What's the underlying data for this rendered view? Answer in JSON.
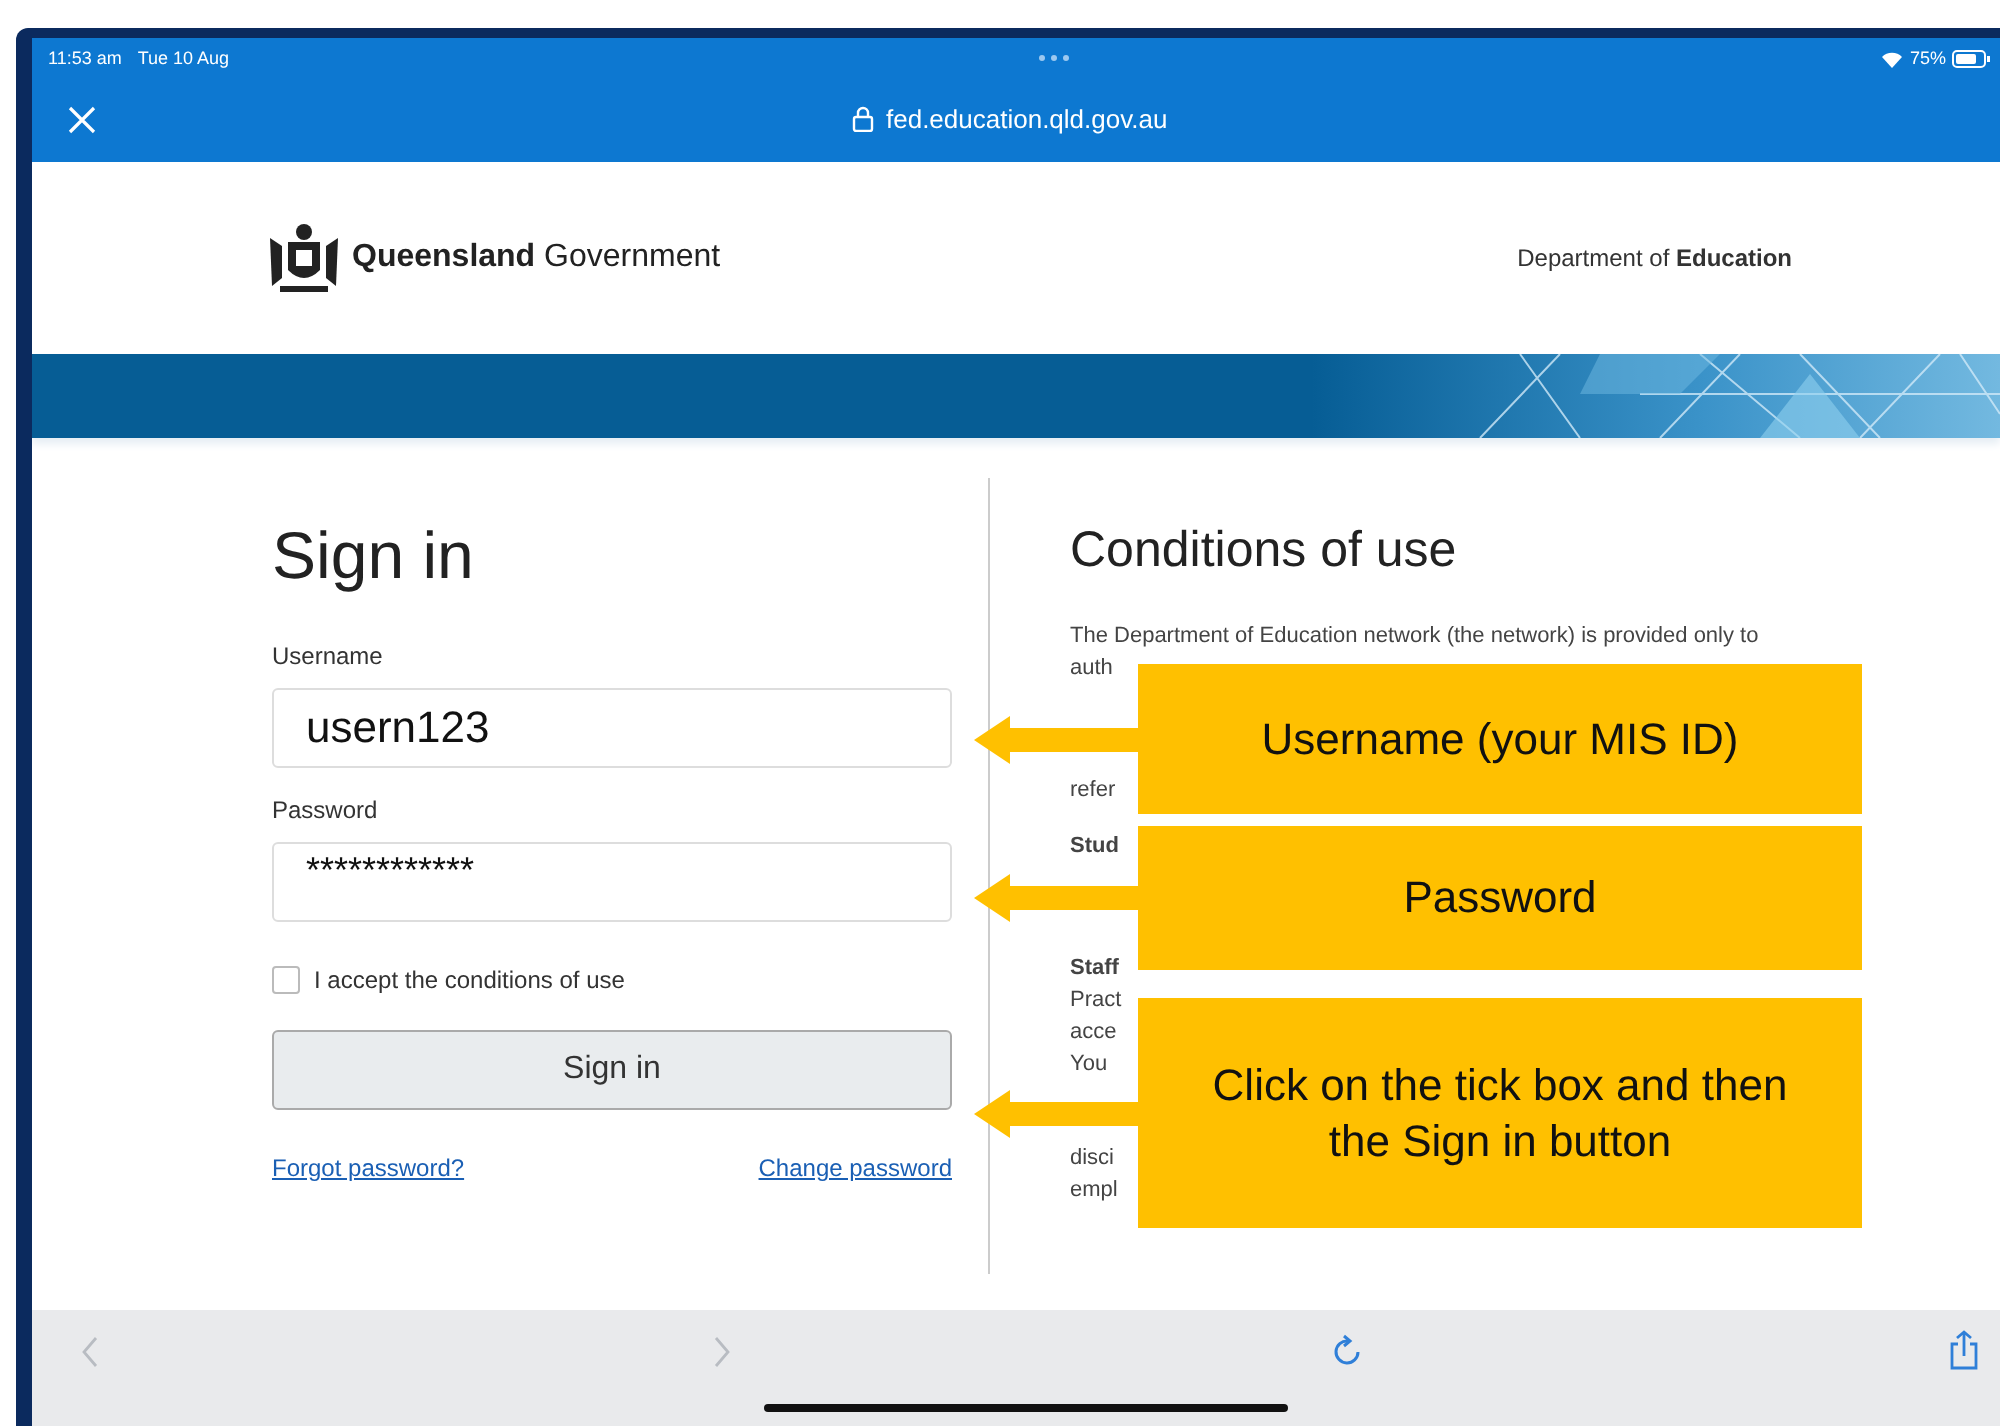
{
  "status_bar": {
    "time": "11:53 am",
    "date": "Tue 10 Aug",
    "battery": "75%"
  },
  "address_bar": {
    "url": "fed.education.qld.gov.au"
  },
  "header": {
    "brand": "**Queensland** Government",
    "department": "Department of **Education**"
  },
  "sign_in": {
    "title": "Sign in",
    "username": {
      "label": "Username",
      "value": "usern123"
    },
    "password": {
      "label": "Password",
      "value": "************"
    },
    "accept": {
      "label": "I accept the conditions of use",
      "checked": false
    },
    "button": "Sign in",
    "links": [
      "Forgot password?",
      "Change password"
    ]
  },
  "conditions": {
    "title": "Conditions of use",
    "paragraphs": [
      [
        "The Department of Education network (the network) is provided only to",
        "auth"
      ],
      [
        "refer"
      ],
      [
        "**Stud**"
      ],
      [
        "**Staff**",
        "Pract",
        "acce",
        "You"
      ],
      [
        "disci",
        "empl"
      ]
    ]
  },
  "callouts": [
    {
      "text": "Username (your MIS ID)"
    },
    {
      "text": "Password"
    },
    {
      "text": "Click on the tick box and then the Sign in button"
    }
  ]
}
